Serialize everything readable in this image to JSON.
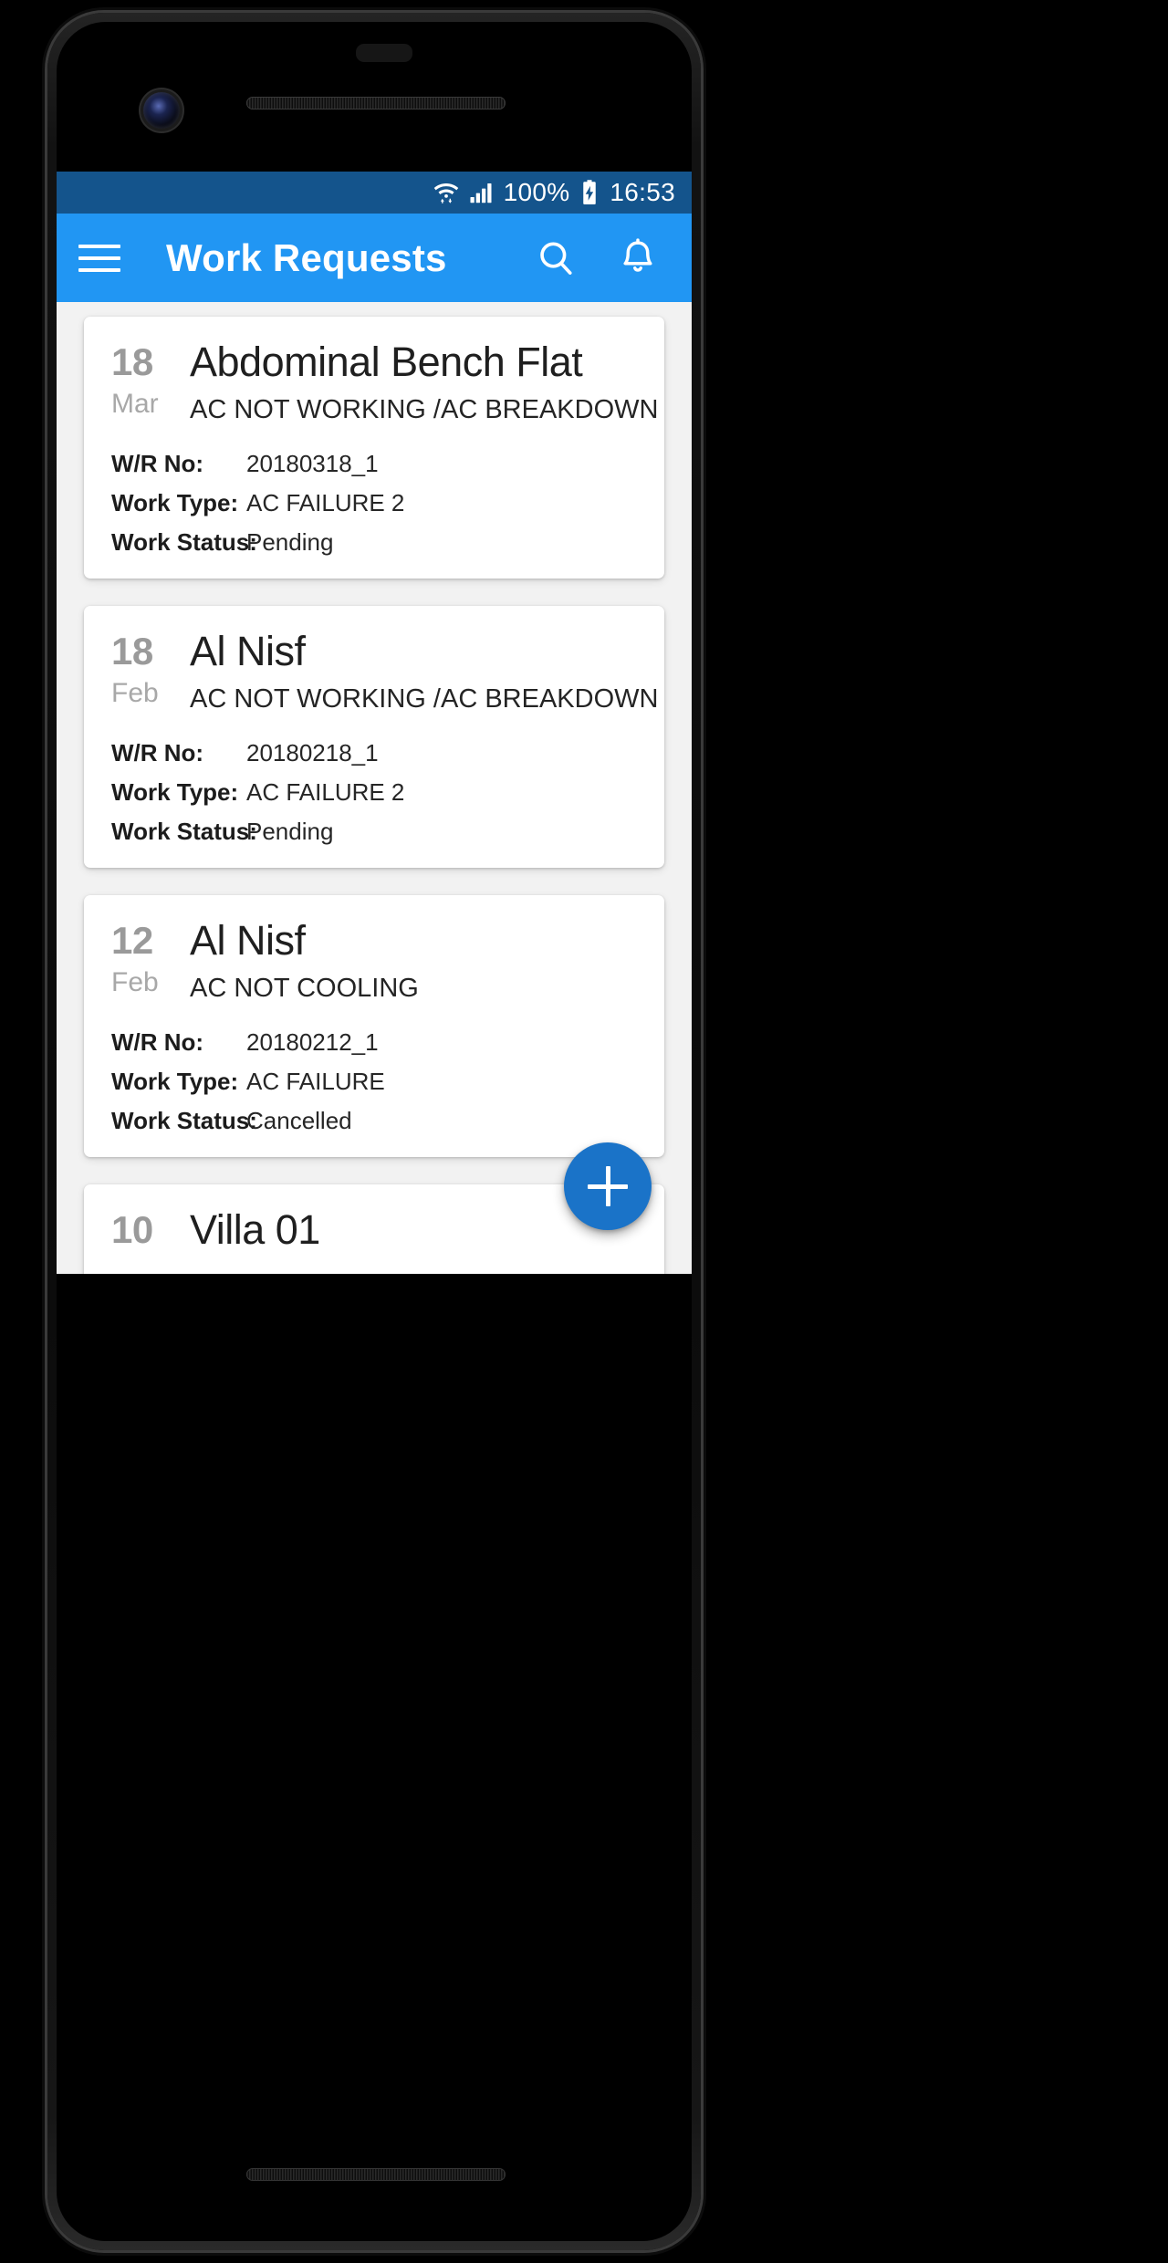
{
  "status_bar": {
    "battery_percent": "100%",
    "time": "16:53",
    "icons": [
      "wifi-icon",
      "cellular-signal-icon",
      "battery-charging-icon"
    ],
    "background_color": "#14548c"
  },
  "app_bar": {
    "title": "Work Requests",
    "menu_icon": "hamburger-menu-icon",
    "search_icon": "search-icon",
    "notification_icon": "bell-icon",
    "background_color": "#2196f3"
  },
  "fab": {
    "icon": "plus-icon",
    "label": "+",
    "color": "#1a73c8"
  },
  "labels": {
    "wr_no": "W/R No:",
    "work_type": "Work Type:",
    "work_status": "Work Status:"
  },
  "cards": [
    {
      "day": "18",
      "month": "Mar",
      "title": "Abdominal Bench Flat",
      "subtitle": "AC NOT WORKING /AC BREAKDOWN",
      "wr_no": "20180318_1",
      "work_type": "AC FAILURE 2",
      "work_status": "Pending"
    },
    {
      "day": "18",
      "month": "Feb",
      "title": "Al Nisf",
      "subtitle": "AC NOT WORKING /AC BREAKDOWN",
      "wr_no": "20180218_1",
      "work_type": "AC FAILURE 2",
      "work_status": "Pending"
    },
    {
      "day": "12",
      "month": "Feb",
      "title": "Al Nisf",
      "subtitle": "AC NOT COOLING",
      "wr_no": "20180212_1",
      "work_type": "AC FAILURE",
      "work_status": "Cancelled"
    },
    {
      "day": "10",
      "month": "",
      "title": "Villa 01",
      "subtitle": "",
      "wr_no": "",
      "work_type": "",
      "work_status": ""
    }
  ]
}
